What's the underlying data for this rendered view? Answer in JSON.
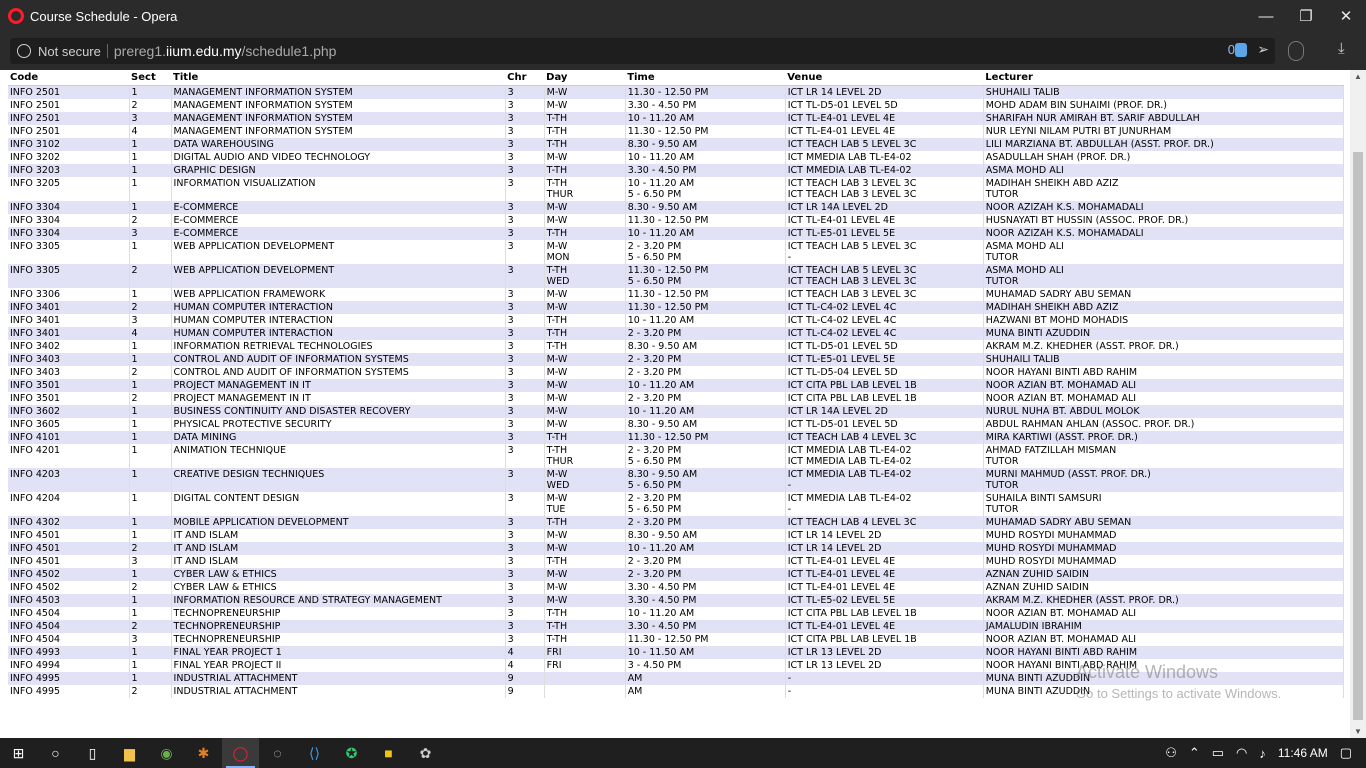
{
  "window": {
    "title": "Course Schedule - Opera",
    "minimize": "—",
    "maximize": "❐",
    "close": "✕"
  },
  "address": {
    "security": "Not secure",
    "url_prefix": "prereg1.",
    "url_domain": "iium.edu.my",
    "url_path": "/schedule1.php",
    "adblock_count": "0"
  },
  "table": {
    "headers": [
      "Code",
      "Sect",
      "Title",
      "Chr",
      "Day",
      "Time",
      "Venue",
      "Lecturer"
    ],
    "rows": [
      {
        "code": "INFO 2501",
        "sect": "1",
        "title": "MANAGEMENT INFORMATION SYSTEM",
        "chr": "3",
        "day": "M-W",
        "time": "11.30 - 12.50 PM",
        "venue": "ICT LR 14 LEVEL 2D",
        "lecturer": "SHUHAILI TALIB"
      },
      {
        "code": "INFO 2501",
        "sect": "2",
        "title": "MANAGEMENT INFORMATION SYSTEM",
        "chr": "3",
        "day": "M-W",
        "time": "3.30 - 4.50 PM",
        "venue": "ICT TL-D5-01 LEVEL 5D",
        "lecturer": "MOHD ADAM BIN SUHAIMI (PROF. DR.)"
      },
      {
        "code": "INFO 2501",
        "sect": "3",
        "title": "MANAGEMENT INFORMATION SYSTEM",
        "chr": "3",
        "day": "T-TH",
        "time": "10 - 11.20 AM",
        "venue": "ICT TL-E4-01 LEVEL 4E",
        "lecturer": "SHARIFAH NUR AMIRAH BT. SARIF ABDULLAH"
      },
      {
        "code": "INFO 2501",
        "sect": "4",
        "title": "MANAGEMENT INFORMATION SYSTEM",
        "chr": "3",
        "day": "T-TH",
        "time": "11.30 - 12.50 PM",
        "venue": "ICT TL-E4-01 LEVEL 4E",
        "lecturer": "NUR LEYNI NILAM PUTRI BT JUNURHAM"
      },
      {
        "code": "INFO 3102",
        "sect": "1",
        "title": "DATA WAREHOUSING",
        "chr": "3",
        "day": "T-TH",
        "time": "8.30 - 9.50 AM",
        "venue": "ICT TEACH LAB 5 LEVEL 3C",
        "lecturer": "LILI MARZIANA BT. ABDULLAH (ASST. PROF. DR.)"
      },
      {
        "code": "INFO 3202",
        "sect": "1",
        "title": "DIGITAL AUDIO AND VIDEO TECHNOLOGY",
        "chr": "3",
        "day": "M-W",
        "time": "10 - 11.20 AM",
        "venue": "ICT MMEDIA LAB TL-E4-02",
        "lecturer": "ASADULLAH SHAH (PROF. DR.)"
      },
      {
        "code": "INFO 3203",
        "sect": "1",
        "title": "GRAPHIC DESIGN",
        "chr": "3",
        "day": "T-TH",
        "time": "3.30 - 4.50 PM",
        "venue": "ICT MMEDIA LAB TL-E4-02",
        "lecturer": "ASMA MOHD ALI"
      },
      {
        "code": "INFO 3205",
        "sect": "1",
        "title": "INFORMATION VISUALIZATION",
        "chr": "3",
        "day": "T-TH",
        "day2": "THUR",
        "time": "10 - 11.20 AM",
        "time2": "5 - 6.50 PM",
        "venue": "ICT TEACH LAB 3 LEVEL 3C",
        "venue2": "ICT TEACH LAB 3 LEVEL 3C",
        "lecturer": "MADIHAH SHEIKH ABD AZIZ",
        "lecturer2": "TUTOR"
      },
      {
        "code": "INFO 3304",
        "sect": "1",
        "title": "E-COMMERCE",
        "chr": "3",
        "day": "M-W",
        "time": "8.30 - 9.50 AM",
        "venue": "ICT LR 14A LEVEL 2D",
        "lecturer": "NOOR AZIZAH K.S. MOHAMADALI"
      },
      {
        "code": "INFO 3304",
        "sect": "2",
        "title": "E-COMMERCE",
        "chr": "3",
        "day": "M-W",
        "time": "11.30 - 12.50 PM",
        "venue": "ICT TL-E4-01 LEVEL 4E",
        "lecturer": "HUSNAYATI BT HUSSIN (ASSOC. PROF. DR.)"
      },
      {
        "code": "INFO 3304",
        "sect": "3",
        "title": "E-COMMERCE",
        "chr": "3",
        "day": "T-TH",
        "time": "10 - 11.20 AM",
        "venue": "ICT TL-E5-01 LEVEL 5E",
        "lecturer": "NOOR AZIZAH K.S. MOHAMADALI"
      },
      {
        "code": "INFO 3305",
        "sect": "1",
        "title": "WEB APPLICATION DEVELOPMENT",
        "chr": "3",
        "day": "M-W",
        "day2": "MON",
        "time": "2 - 3.20 PM",
        "time2": "5 - 6.50 PM",
        "venue": "ICT TEACH LAB 5 LEVEL 3C",
        "venue2": "-",
        "lecturer": "ASMA MOHD ALI",
        "lecturer2": "TUTOR"
      },
      {
        "code": "INFO 3305",
        "sect": "2",
        "title": "WEB APPLICATION DEVELOPMENT",
        "chr": "3",
        "day": "T-TH",
        "day2": "WED",
        "time": "11.30 - 12.50 PM",
        "time2": "5 - 6.50 PM",
        "venue": "ICT TEACH LAB 5 LEVEL 3C",
        "venue2": "ICT TEACH LAB 3 LEVEL 3C",
        "lecturer": "ASMA MOHD ALI",
        "lecturer2": "TUTOR"
      },
      {
        "code": "INFO 3306",
        "sect": "1",
        "title": "WEB APPLICATION FRAMEWORK",
        "chr": "3",
        "day": "M-W",
        "time": "11.30 - 12.50 PM",
        "venue": "ICT TEACH LAB 3 LEVEL 3C",
        "lecturer": "MUHAMAD SADRY ABU SEMAN"
      },
      {
        "code": "INFO 3401",
        "sect": "2",
        "title": "HUMAN COMPUTER INTERACTION",
        "chr": "3",
        "day": "M-W",
        "time": "11.30 - 12.50 PM",
        "venue": "ICT TL-C4-02 LEVEL 4C",
        "lecturer": "MADIHAH SHEIKH ABD AZIZ"
      },
      {
        "code": "INFO 3401",
        "sect": "3",
        "title": "HUMAN COMPUTER INTERACTION",
        "chr": "3",
        "day": "T-TH",
        "time": "10 - 11.20 AM",
        "venue": "ICT TL-C4-02 LEVEL 4C",
        "lecturer": "HAZWANI BT MOHD MOHADIS"
      },
      {
        "code": "INFO 3401",
        "sect": "4",
        "title": "HUMAN COMPUTER INTERACTION",
        "chr": "3",
        "day": "T-TH",
        "time": "2 - 3.20 PM",
        "venue": "ICT TL-C4-02 LEVEL 4C",
        "lecturer": "MUNA BINTI AZUDDIN"
      },
      {
        "code": "INFO 3402",
        "sect": "1",
        "title": "INFORMATION RETRIEVAL TECHNOLOGIES",
        "chr": "3",
        "day": "T-TH",
        "time": "8.30 - 9.50 AM",
        "venue": "ICT TL-D5-01 LEVEL 5D",
        "lecturer": "AKRAM M.Z. KHEDHER (ASST. PROF. DR.)"
      },
      {
        "code": "INFO 3403",
        "sect": "1",
        "title": "CONTROL AND AUDIT OF INFORMATION SYSTEMS",
        "chr": "3",
        "day": "M-W",
        "time": "2 - 3.20 PM",
        "venue": "ICT TL-E5-01 LEVEL 5E",
        "lecturer": "SHUHAILI TALIB"
      },
      {
        "code": "INFO 3403",
        "sect": "2",
        "title": "CONTROL AND AUDIT OF INFORMATION SYSTEMS",
        "chr": "3",
        "day": "M-W",
        "time": "2 - 3.20 PM",
        "venue": "ICT TL-D5-04 LEVEL 5D",
        "lecturer": "NOOR HAYANI BINTI ABD RAHIM"
      },
      {
        "code": "INFO 3501",
        "sect": "1",
        "title": "PROJECT MANAGEMENT IN IT",
        "chr": "3",
        "day": "M-W",
        "time": "10 - 11.20 AM",
        "venue": "ICT CITA PBL LAB LEVEL 1B",
        "lecturer": "NOOR AZIAN BT. MOHAMAD ALI"
      },
      {
        "code": "INFO 3501",
        "sect": "2",
        "title": "PROJECT MANAGEMENT IN IT",
        "chr": "3",
        "day": "M-W",
        "time": "2 - 3.20 PM",
        "venue": "ICT CITA PBL LAB LEVEL 1B",
        "lecturer": "NOOR AZIAN BT. MOHAMAD ALI"
      },
      {
        "code": "INFO 3602",
        "sect": "1",
        "title": "BUSINESS CONTINUITY AND DISASTER RECOVERY",
        "chr": "3",
        "day": "M-W",
        "time": "10 - 11.20 AM",
        "venue": "ICT LR 14A LEVEL 2D",
        "lecturer": "NURUL NUHA BT. ABDUL MOLOK"
      },
      {
        "code": "INFO 3605",
        "sect": "1",
        "title": "PHYSICAL PROTECTIVE SECURITY",
        "chr": "3",
        "day": "M-W",
        "time": "8.30 - 9.50 AM",
        "venue": "ICT TL-D5-01 LEVEL 5D",
        "lecturer": "ABDUL RAHMAN AHLAN (ASSOC. PROF. DR.)"
      },
      {
        "code": "INFO 4101",
        "sect": "1",
        "title": "DATA MINING",
        "chr": "3",
        "day": "T-TH",
        "time": "11.30 - 12.50 PM",
        "venue": "ICT TEACH LAB 4 LEVEL 3C",
        "lecturer": "MIRA KARTIWI (ASST. PROF. DR.)"
      },
      {
        "code": "INFO 4201",
        "sect": "1",
        "title": "ANIMATION TECHNIQUE",
        "chr": "3",
        "day": "T-TH",
        "day2": "THUR",
        "time": "2 - 3.20 PM",
        "time2": "5 - 6.50 PM",
        "venue": "ICT MMEDIA LAB TL-E4-02",
        "venue2": "ICT MMEDIA LAB TL-E4-02",
        "lecturer": "AHMAD FATZILLAH MISMAN",
        "lecturer2": "TUTOR"
      },
      {
        "code": "INFO 4203",
        "sect": "1",
        "title": "CREATIVE DESIGN TECHNIQUES",
        "chr": "3",
        "day": "M-W",
        "day2": "WED",
        "time": "8.30 - 9.50 AM",
        "time2": "5 - 6.50 PM",
        "venue": "ICT MMEDIA LAB TL-E4-02",
        "venue2": "-",
        "lecturer": "MURNI MAHMUD (ASST. PROF. DR.)",
        "lecturer2": "TUTOR"
      },
      {
        "code": "INFO 4204",
        "sect": "1",
        "title": "DIGITAL CONTENT DESIGN",
        "chr": "3",
        "day": "M-W",
        "day2": "TUE",
        "time": "2 - 3.20 PM",
        "time2": "5 - 6.50 PM",
        "venue": "ICT MMEDIA LAB TL-E4-02",
        "venue2": "-",
        "lecturer": "SUHAILA BINTI SAMSURI",
        "lecturer2": "TUTOR"
      },
      {
        "code": "INFO 4302",
        "sect": "1",
        "title": "MOBILE APPLICATION DEVELOPMENT",
        "chr": "3",
        "day": "T-TH",
        "time": "2 - 3.20 PM",
        "venue": "ICT TEACH LAB 4 LEVEL 3C",
        "lecturer": "MUHAMAD SADRY ABU SEMAN"
      },
      {
        "code": "INFO 4501",
        "sect": "1",
        "title": "IT AND ISLAM",
        "chr": "3",
        "day": "M-W",
        "time": "8.30 - 9.50 AM",
        "venue": "ICT LR 14 LEVEL 2D",
        "lecturer": "MUHD ROSYDI MUHAMMAD"
      },
      {
        "code": "INFO 4501",
        "sect": "2",
        "title": "IT AND ISLAM",
        "chr": "3",
        "day": "M-W",
        "time": "10 - 11.20 AM",
        "venue": "ICT LR 14 LEVEL 2D",
        "lecturer": "MUHD ROSYDI MUHAMMAD"
      },
      {
        "code": "INFO 4501",
        "sect": "3",
        "title": "IT AND ISLAM",
        "chr": "3",
        "day": "T-TH",
        "time": "2 - 3.20 PM",
        "venue": "ICT TL-E4-01 LEVEL 4E",
        "lecturer": "MUHD ROSYDI MUHAMMAD"
      },
      {
        "code": "INFO 4502",
        "sect": "1",
        "title": "CYBER LAW & ETHICS",
        "chr": "3",
        "day": "M-W",
        "time": "2 - 3.20 PM",
        "venue": "ICT TL-E4-01 LEVEL 4E",
        "lecturer": "AZNAN ZUHID SAIDIN"
      },
      {
        "code": "INFO 4502",
        "sect": "2",
        "title": "CYBER LAW & ETHICS",
        "chr": "3",
        "day": "M-W",
        "time": "3.30 - 4.50 PM",
        "venue": "ICT TL-E4-01 LEVEL 4E",
        "lecturer": "AZNAN ZUHID SAIDIN"
      },
      {
        "code": "INFO 4503",
        "sect": "1",
        "title": "INFORMATION RESOURCE AND STRATEGY MANAGEMENT",
        "chr": "3",
        "day": "M-W",
        "time": "3.30 - 4.50 PM",
        "venue": "ICT TL-E5-02 LEVEL 5E",
        "lecturer": "AKRAM M.Z. KHEDHER (ASST. PROF. DR.)"
      },
      {
        "code": "INFO 4504",
        "sect": "1",
        "title": "TECHNOPRENEURSHIP",
        "chr": "3",
        "day": "T-TH",
        "time": "10 - 11.20 AM",
        "venue": "ICT CITA PBL LAB LEVEL 1B",
        "lecturer": "NOOR AZIAN BT. MOHAMAD ALI"
      },
      {
        "code": "INFO 4504",
        "sect": "2",
        "title": "TECHNOPRENEURSHIP",
        "chr": "3",
        "day": "T-TH",
        "time": "3.30 - 4.50 PM",
        "venue": "ICT TL-E4-01 LEVEL 4E",
        "lecturer": "JAMALUDIN IBRAHIM"
      },
      {
        "code": "INFO 4504",
        "sect": "3",
        "title": "TECHNOPRENEURSHIP",
        "chr": "3",
        "day": "T-TH",
        "time": "11.30 - 12.50 PM",
        "venue": "ICT CITA PBL LAB LEVEL 1B",
        "lecturer": "NOOR AZIAN BT. MOHAMAD ALI"
      },
      {
        "code": "INFO 4993",
        "sect": "1",
        "title": "FINAL YEAR PROJECT 1",
        "chr": "4",
        "day": "FRI",
        "time": "10 - 11.50 AM",
        "venue": "ICT LR 13 LEVEL 2D",
        "lecturer": "NOOR HAYANI BINTI ABD RAHIM"
      },
      {
        "code": "INFO 4994",
        "sect": "1",
        "title": "FINAL YEAR PROJECT II",
        "chr": "4",
        "day": "FRI",
        "time": "3 - 4.50 PM",
        "venue": "ICT LR 13 LEVEL 2D",
        "lecturer": "NOOR HAYANI BINTI ABD RAHIM"
      },
      {
        "code": "INFO 4995",
        "sect": "1",
        "title": "INDUSTRIAL ATTACHMENT",
        "chr": "9",
        "day": "",
        "time": "AM",
        "venue": "-",
        "lecturer": "MUNA BINTI AZUDDIN"
      },
      {
        "code": "INFO 4995",
        "sect": "2",
        "title": "INDUSTRIAL ATTACHMENT",
        "chr": "9",
        "day": "",
        "time": "AM",
        "venue": "-",
        "lecturer": "MUNA BINTI AZUDDIN"
      }
    ]
  },
  "watermark": {
    "line1": "Activate Windows",
    "line2": "Go to Settings to activate Windows."
  },
  "taskbar": {
    "clock": "11:46 AM"
  }
}
